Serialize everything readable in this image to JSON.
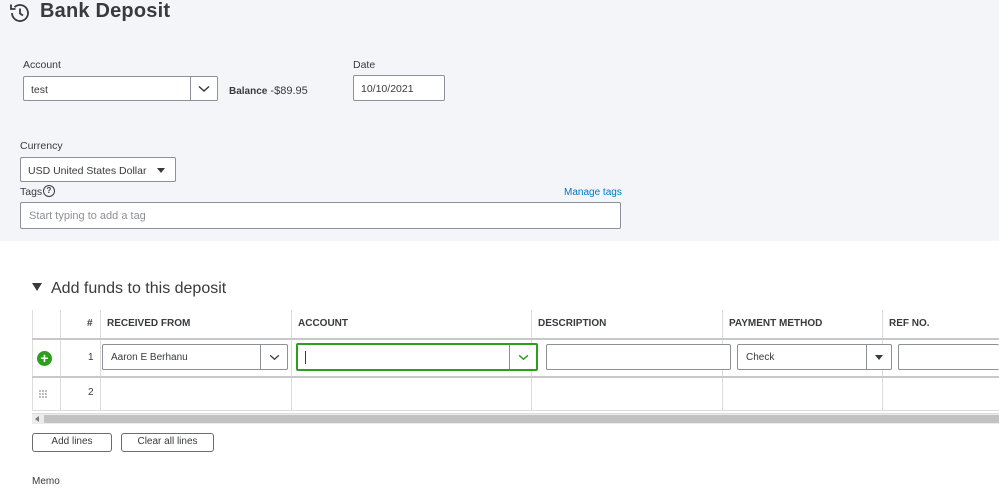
{
  "header": {
    "title": "Bank Deposit",
    "icon": "clock-refresh-icon"
  },
  "account": {
    "label": "Account",
    "value": "test",
    "balance_label": "Balance",
    "balance_value": "-$89.95"
  },
  "date": {
    "label": "Date",
    "value": "10/10/2021"
  },
  "currency": {
    "label": "Currency",
    "value": "USD United States Dollar"
  },
  "tags": {
    "label": "Tags",
    "help": "?",
    "manage_link": "Manage tags",
    "placeholder": "Start typing to add a tag"
  },
  "deposit": {
    "section_title": "Add funds to this deposit",
    "columns": [
      "#",
      "RECEIVED FROM",
      "ACCOUNT",
      "DESCRIPTION",
      "PAYMENT METHOD",
      "REF NO."
    ],
    "rows": [
      {
        "num": "1",
        "received_from": "Aaron E Berhanu",
        "account": "",
        "description": "",
        "payment_method": "Check",
        "ref_no": ""
      },
      {
        "num": "2",
        "received_from": "",
        "account": "",
        "description": "",
        "payment_method": "",
        "ref_no": ""
      }
    ],
    "add_lines": "Add lines",
    "clear_lines": "Clear all lines"
  },
  "memo": {
    "label": "Memo"
  },
  "colors": {
    "accent_green": "#2ca01c",
    "link_blue": "#0077c5",
    "panel_bg": "#f4f5f8"
  }
}
